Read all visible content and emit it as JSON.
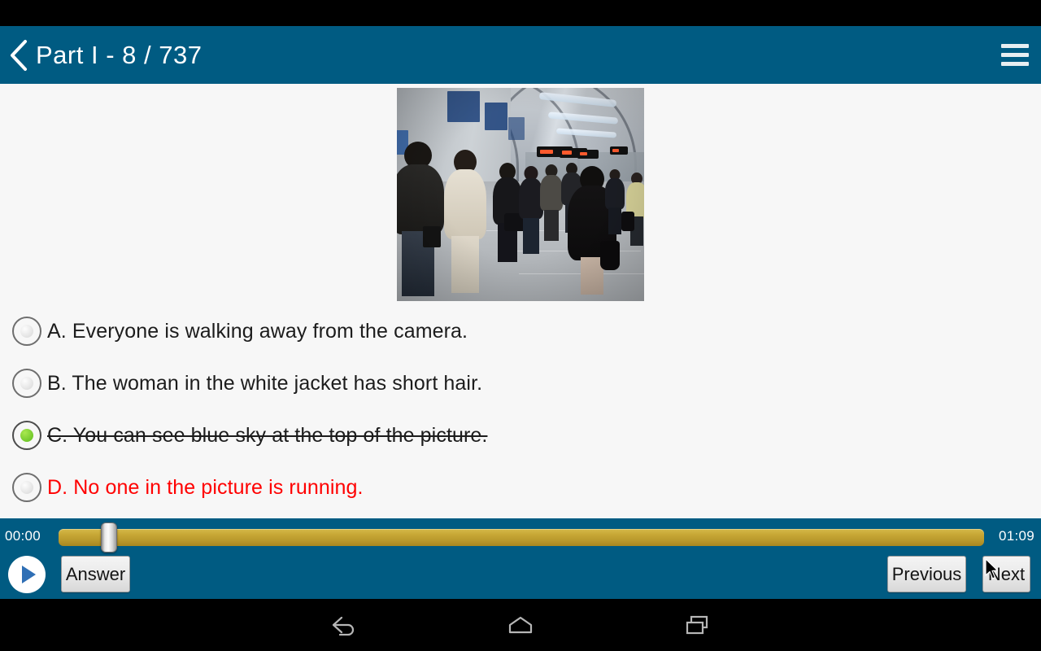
{
  "header": {
    "back_icon": "chevron-left-icon",
    "title": "Part I  -  8 / 737",
    "menu_icon": "hamburger-menu-icon",
    "background_color": "#005b82"
  },
  "question": {
    "image_alt": "Crowded train station platform with people walking away from camera",
    "options": [
      {
        "letter": "A",
        "label": "A. Everyone is walking away from the camera.",
        "selected": false,
        "state": "normal"
      },
      {
        "letter": "B",
        "label": "B. The woman in the white jacket has short hair.",
        "selected": false,
        "state": "normal"
      },
      {
        "letter": "C",
        "label": "C. You can see blue sky at the top of the picture.",
        "selected": true,
        "state": "struck"
      },
      {
        "letter": "D",
        "label": "D. No one in the picture is running.",
        "selected": false,
        "state": "correct"
      }
    ],
    "correct_color": "#ff0000",
    "selected_color": "#7ac93a"
  },
  "player": {
    "current_time": "00:00",
    "total_time": "01:09",
    "progress_percent": 0,
    "play_icon": "play-triangle-icon",
    "track_color": "#c9a937",
    "answer_label": "Answer",
    "previous_label": "Previous",
    "next_label": "Next"
  },
  "navbar": {
    "back_icon": "android-back-icon",
    "home_icon": "android-home-icon",
    "recents_icon": "android-recents-icon"
  }
}
